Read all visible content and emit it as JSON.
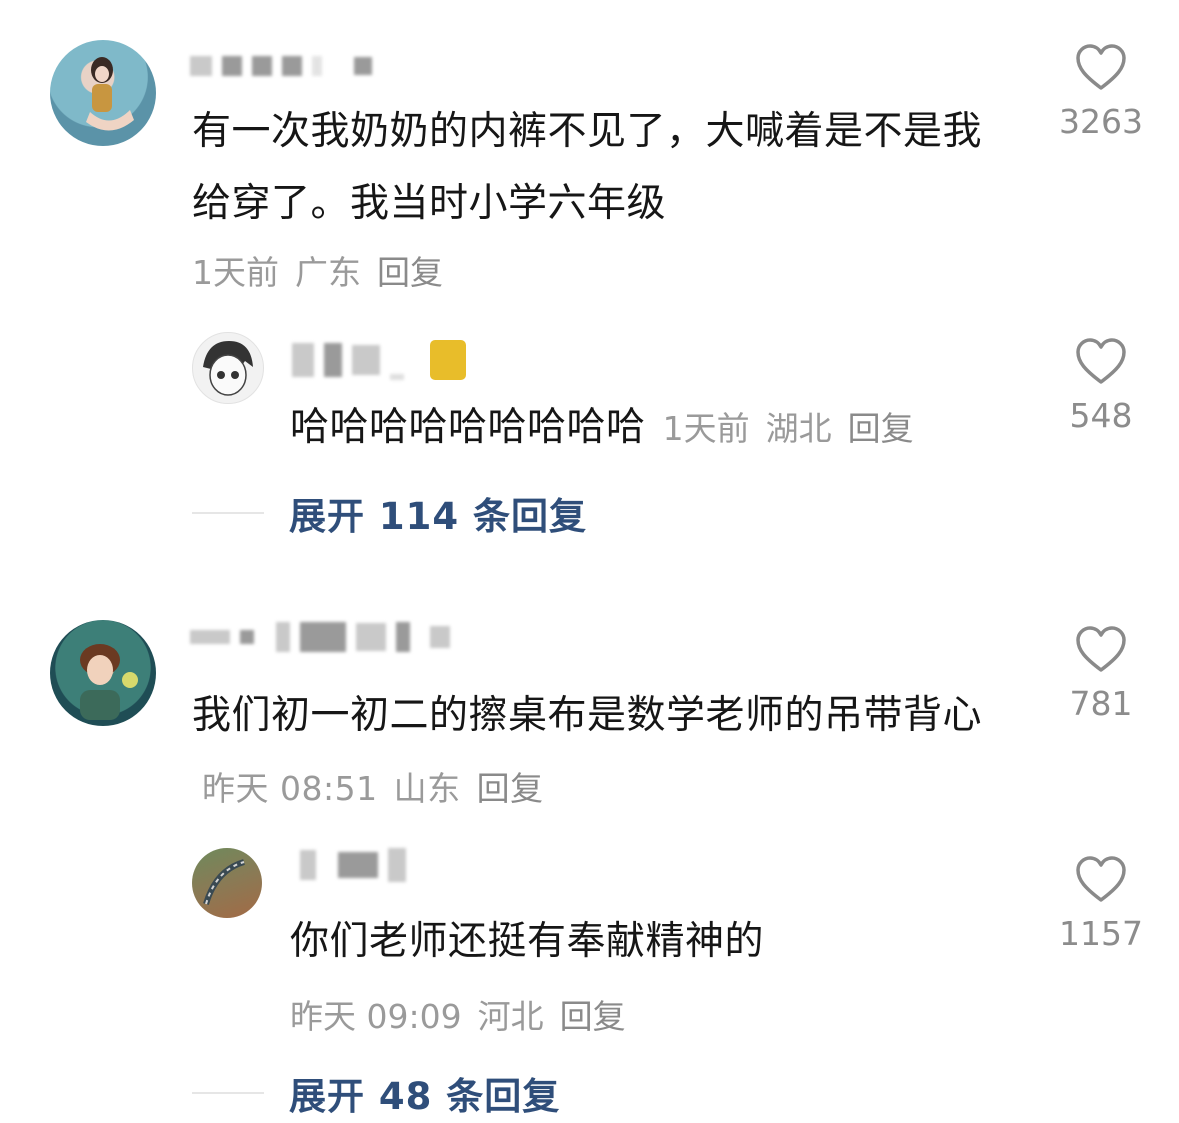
{
  "comments": [
    {
      "text": "有一次我奶奶的内裤不见了，大喊着是不是我给穿了。我当时小学六年级",
      "time": "1天前",
      "location": "广东",
      "reply_label": "回复",
      "likes": "3263",
      "replies": [
        {
          "text": "哈哈哈哈哈哈哈哈哈",
          "time": "1天前",
          "location": "湖北",
          "reply_label": "回复",
          "likes": "548"
        }
      ],
      "expand_label": "展开 114 条回复"
    },
    {
      "text": "我们初一初二的擦桌布是数学老师的吊带背心",
      "time": "昨天 08:51",
      "location": "山东",
      "reply_label": "回复",
      "likes": "781",
      "replies": [
        {
          "text": "你们老师还挺有奉献精神的",
          "time": "昨天 09:09",
          "location": "河北",
          "reply_label": "回复",
          "likes": "1157"
        }
      ],
      "expand_label": "展开 48 条回复"
    }
  ],
  "colors": {
    "expand_link": "#2f4e7a",
    "meta_gray": "#9a9a9a",
    "badge": "#e8bd2a"
  }
}
